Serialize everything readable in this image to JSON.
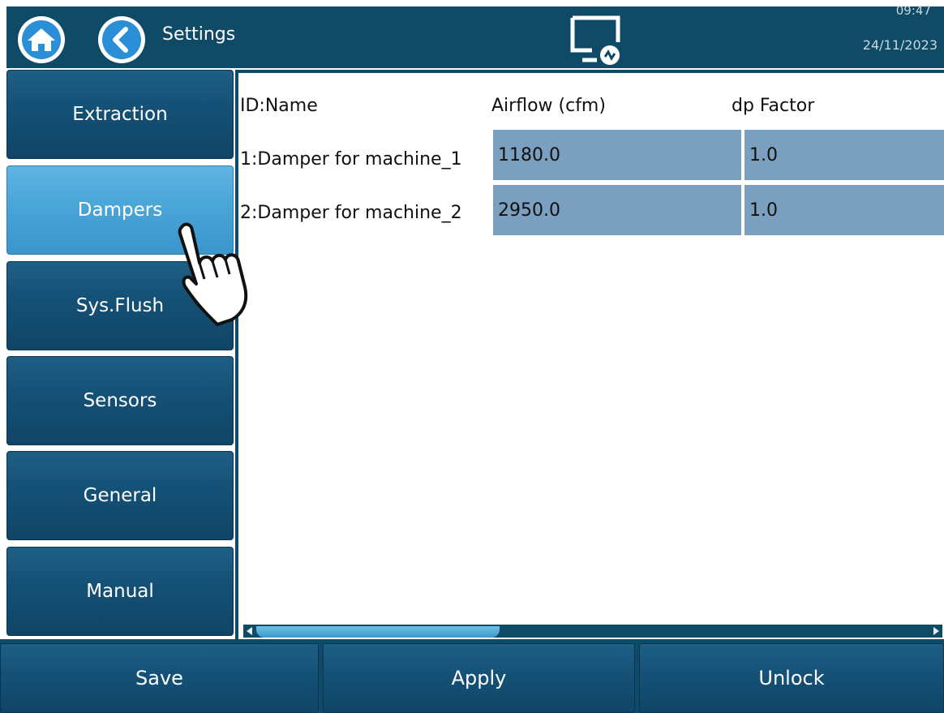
{
  "header": {
    "title": "Settings",
    "time": "09:47",
    "date": "24/11/2023",
    "icons": {
      "home": "home-icon",
      "back": "chevron-left-icon",
      "remote": "remote-desktop-icon"
    }
  },
  "sidebar": {
    "items": [
      {
        "label": "Extraction",
        "active": false
      },
      {
        "label": "Dampers",
        "active": true
      },
      {
        "label": "Sys.Flush",
        "active": false
      },
      {
        "label": "Sensors",
        "active": false
      },
      {
        "label": "General",
        "active": false
      },
      {
        "label": "Manual",
        "active": false
      }
    ]
  },
  "table": {
    "columns": [
      "ID:Name",
      "Airflow  (cfm)",
      "dp Factor"
    ],
    "rows": [
      {
        "name": "1:Damper for machine_1",
        "airflow": "1180.0",
        "dp_factor": "1.0"
      },
      {
        "name": "2:Damper for machine_2",
        "airflow": "2950.0",
        "dp_factor": "1.0"
      }
    ]
  },
  "footer": {
    "buttons": [
      "Save",
      "Apply",
      "Unlock"
    ]
  },
  "colors": {
    "bar": "#0f4a66",
    "button": "#155177",
    "active_button": "#4aa5d8",
    "cell": "#7a9fbf"
  }
}
